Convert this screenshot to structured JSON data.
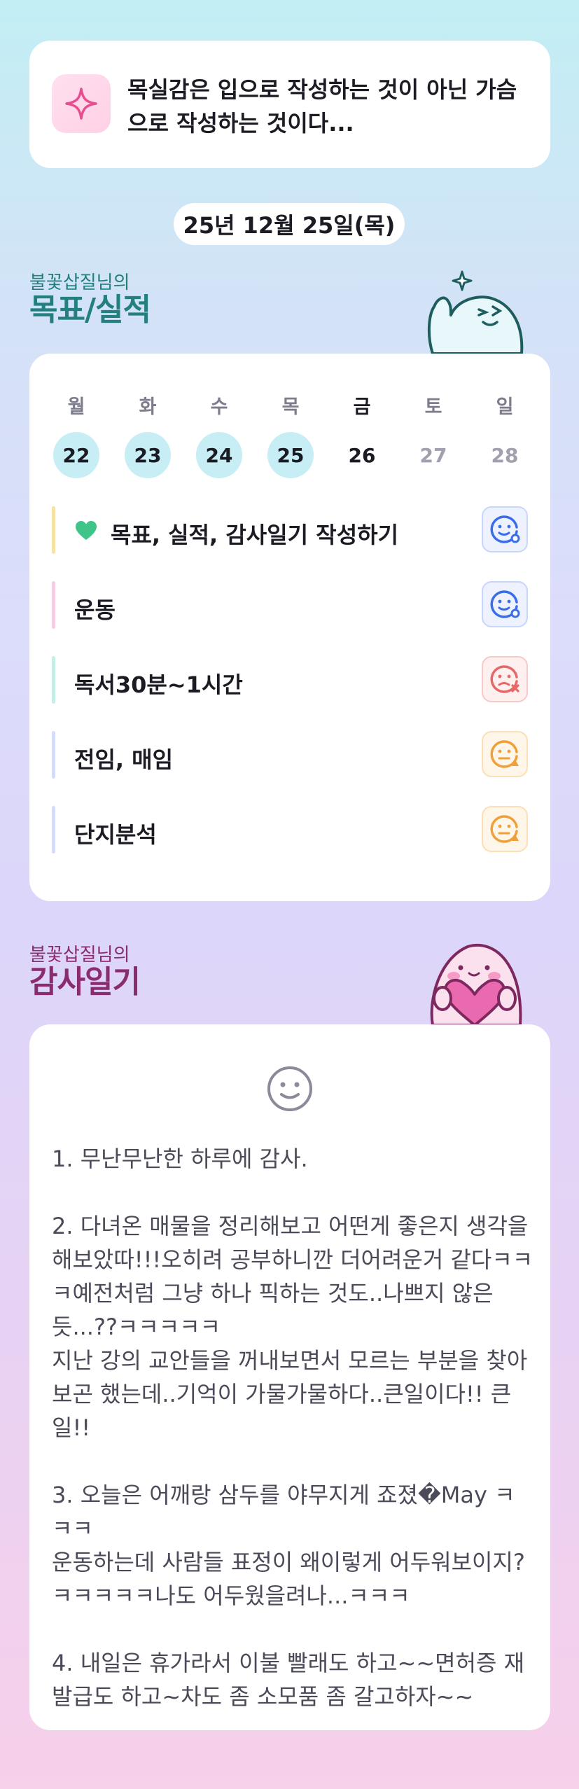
{
  "quote": {
    "text": "목실감은 입으로 작성하는 것이 아닌 가슴으로 작성하는 것이다..."
  },
  "date": "25년 12월 25일(목)",
  "goals_section": {
    "sub": "불꽃삽질님의",
    "title": "목표/실적"
  },
  "week": [
    {
      "day": "월",
      "date": "22",
      "state": "done"
    },
    {
      "day": "화",
      "date": "23",
      "state": "done"
    },
    {
      "day": "수",
      "date": "24",
      "state": "done"
    },
    {
      "day": "목",
      "date": "25",
      "state": "done"
    },
    {
      "day": "금",
      "date": "26",
      "state": "today"
    },
    {
      "day": "토",
      "date": "27",
      "state": "future"
    },
    {
      "day": "일",
      "date": "28",
      "state": "future"
    }
  ],
  "goals": [
    {
      "label": "목표, 실적, 감사일기 작성하기",
      "status": "done",
      "bar_color": "#f7e2a6",
      "icon": "green-heart-icon"
    },
    {
      "label": "운동",
      "status": "done",
      "bar_color": "#f6cde3"
    },
    {
      "label": "독서30분~1시간",
      "status": "failed",
      "bar_color": "#c5efe4"
    },
    {
      "label": "전임, 매임",
      "status": "partial",
      "bar_color": "#d4dcf9"
    },
    {
      "label": "단지분석",
      "status": "partial",
      "bar_color": "#d4dcf9"
    }
  ],
  "status_colors": {
    "done": "#3a6ee8",
    "failed": "#e56767",
    "partial": "#f0a03a"
  },
  "diary_section": {
    "sub": "불꽃삽질님의",
    "title": "감사일기"
  },
  "diary": {
    "mood_icon": "neutral-smile-icon",
    "text": "1. 무난무난한 하루에 감사.\n\n2. 다녀온 매물을 정리해보고 어떤게 좋은지 생각을 해보았따!!!오히려 공부하니깐 더어려운거 같다ㅋㅋㅋ예전처럼 그냥 하나 픽하는 것도..나쁘지 않은듯...??ㅋㅋㅋㅋㅋ\n지난 강의 교안들을 꺼내보면서 모르는 부분을 찾아보곤 했는데..기억이 가물가물하다..큰일이다!! 큰일!!\n\n3. 오늘은 어깨랑 삼두를 야무지게 죠졌�May ㅋㅋㅋ\n운동하는데 사람들 표정이 왜이렇게 어두워보이지?ㅋㅋㅋㅋㅋ나도 어두웠을려나...ㅋㅋㅋ\n\n4. 내일은 휴가라서 이불 빨래도 하고~~면허증 재발급도 하고~차도 좀 소모품 좀 갈고하자~~"
  }
}
